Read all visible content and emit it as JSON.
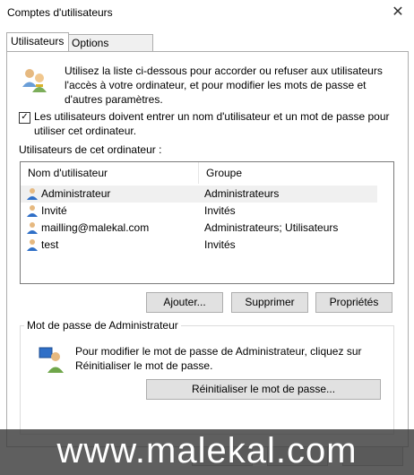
{
  "window": {
    "title": "Comptes d'utilisateurs"
  },
  "tabs": [
    {
      "label": "Utilisateurs"
    },
    {
      "label": "Options avancées"
    }
  ],
  "intro_text": "Utilisez la liste ci-dessous pour accorder ou refuser aux utilisateurs l'accès à votre ordinateur, et pour modifier les mots de passe et d'autres paramètres.",
  "require_login": {
    "checked": true,
    "label": "Les utilisateurs doivent entrer un nom d'utilisateur et un mot de passe pour utiliser cet ordinateur."
  },
  "users_list": {
    "caption": "Utilisateurs de cet ordinateur :",
    "columns": [
      "Nom d'utilisateur",
      "Groupe"
    ],
    "rows": [
      {
        "name": "Administrateur",
        "group": "Administrateurs"
      },
      {
        "name": "Invité",
        "group": "Invités"
      },
      {
        "name": "mailling@malekal.com",
        "group": "Administrateurs; Utilisateurs"
      },
      {
        "name": "test",
        "group": "Invités"
      }
    ],
    "selected_index": 0
  },
  "buttons": {
    "add": "Ajouter...",
    "remove": "Supprimer",
    "properties": "Propriétés"
  },
  "admin_password": {
    "title": "Mot de passe de Administrateur",
    "text": "Pour modifier le mot de passe de Administrateur, cliquez sur Réinitialiser le mot de passe.",
    "reset_button": "Réinitialiser le mot de passe..."
  },
  "watermark": "www.malekal.com"
}
